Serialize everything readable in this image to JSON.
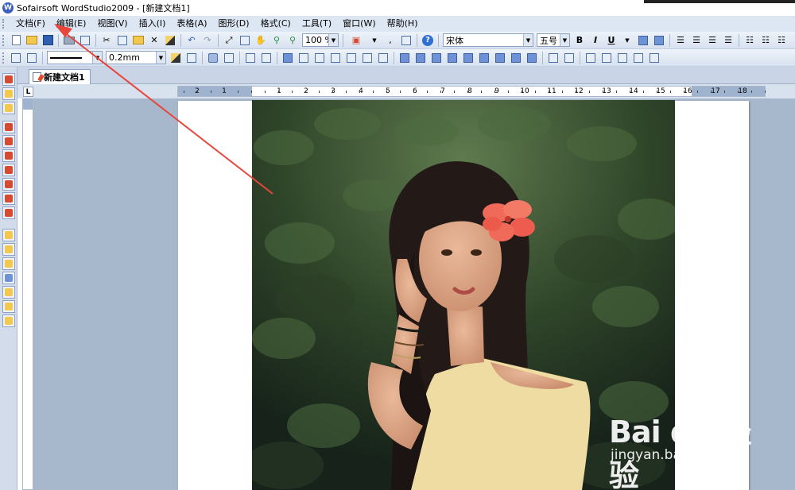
{
  "window": {
    "title": "Sofairsoft WordStudio2009 - [新建文档1]"
  },
  "menu": [
    "文档(F)",
    "编辑(E)",
    "视图(V)",
    "插入(I)",
    "表格(A)",
    "图形(D)",
    "格式(C)",
    "工具(T)",
    "窗口(W)",
    "帮助(H)"
  ],
  "toolbar1": {
    "zoom": "100 %",
    "font_name": "宋体",
    "font_size": "五号",
    "bold": "B",
    "italic": "I",
    "underline": "U"
  },
  "toolbar2": {
    "line_width": "0.2mm"
  },
  "tabs": [
    {
      "label": "新建文档1"
    }
  ],
  "ruler": {
    "corner": "L",
    "numbers": [
      "2",
      "1",
      "1",
      "2",
      "3",
      "4",
      "5",
      "6",
      "7",
      "8",
      "9",
      "10",
      "11",
      "12",
      "13",
      "14",
      "15",
      "16",
      "17",
      "18"
    ]
  },
  "watermark": {
    "logo": "Bai du 经验",
    "url": "jingyan.baidu.com"
  },
  "annotation": {
    "color": "#e8453c",
    "points_to": "编辑(E)"
  }
}
